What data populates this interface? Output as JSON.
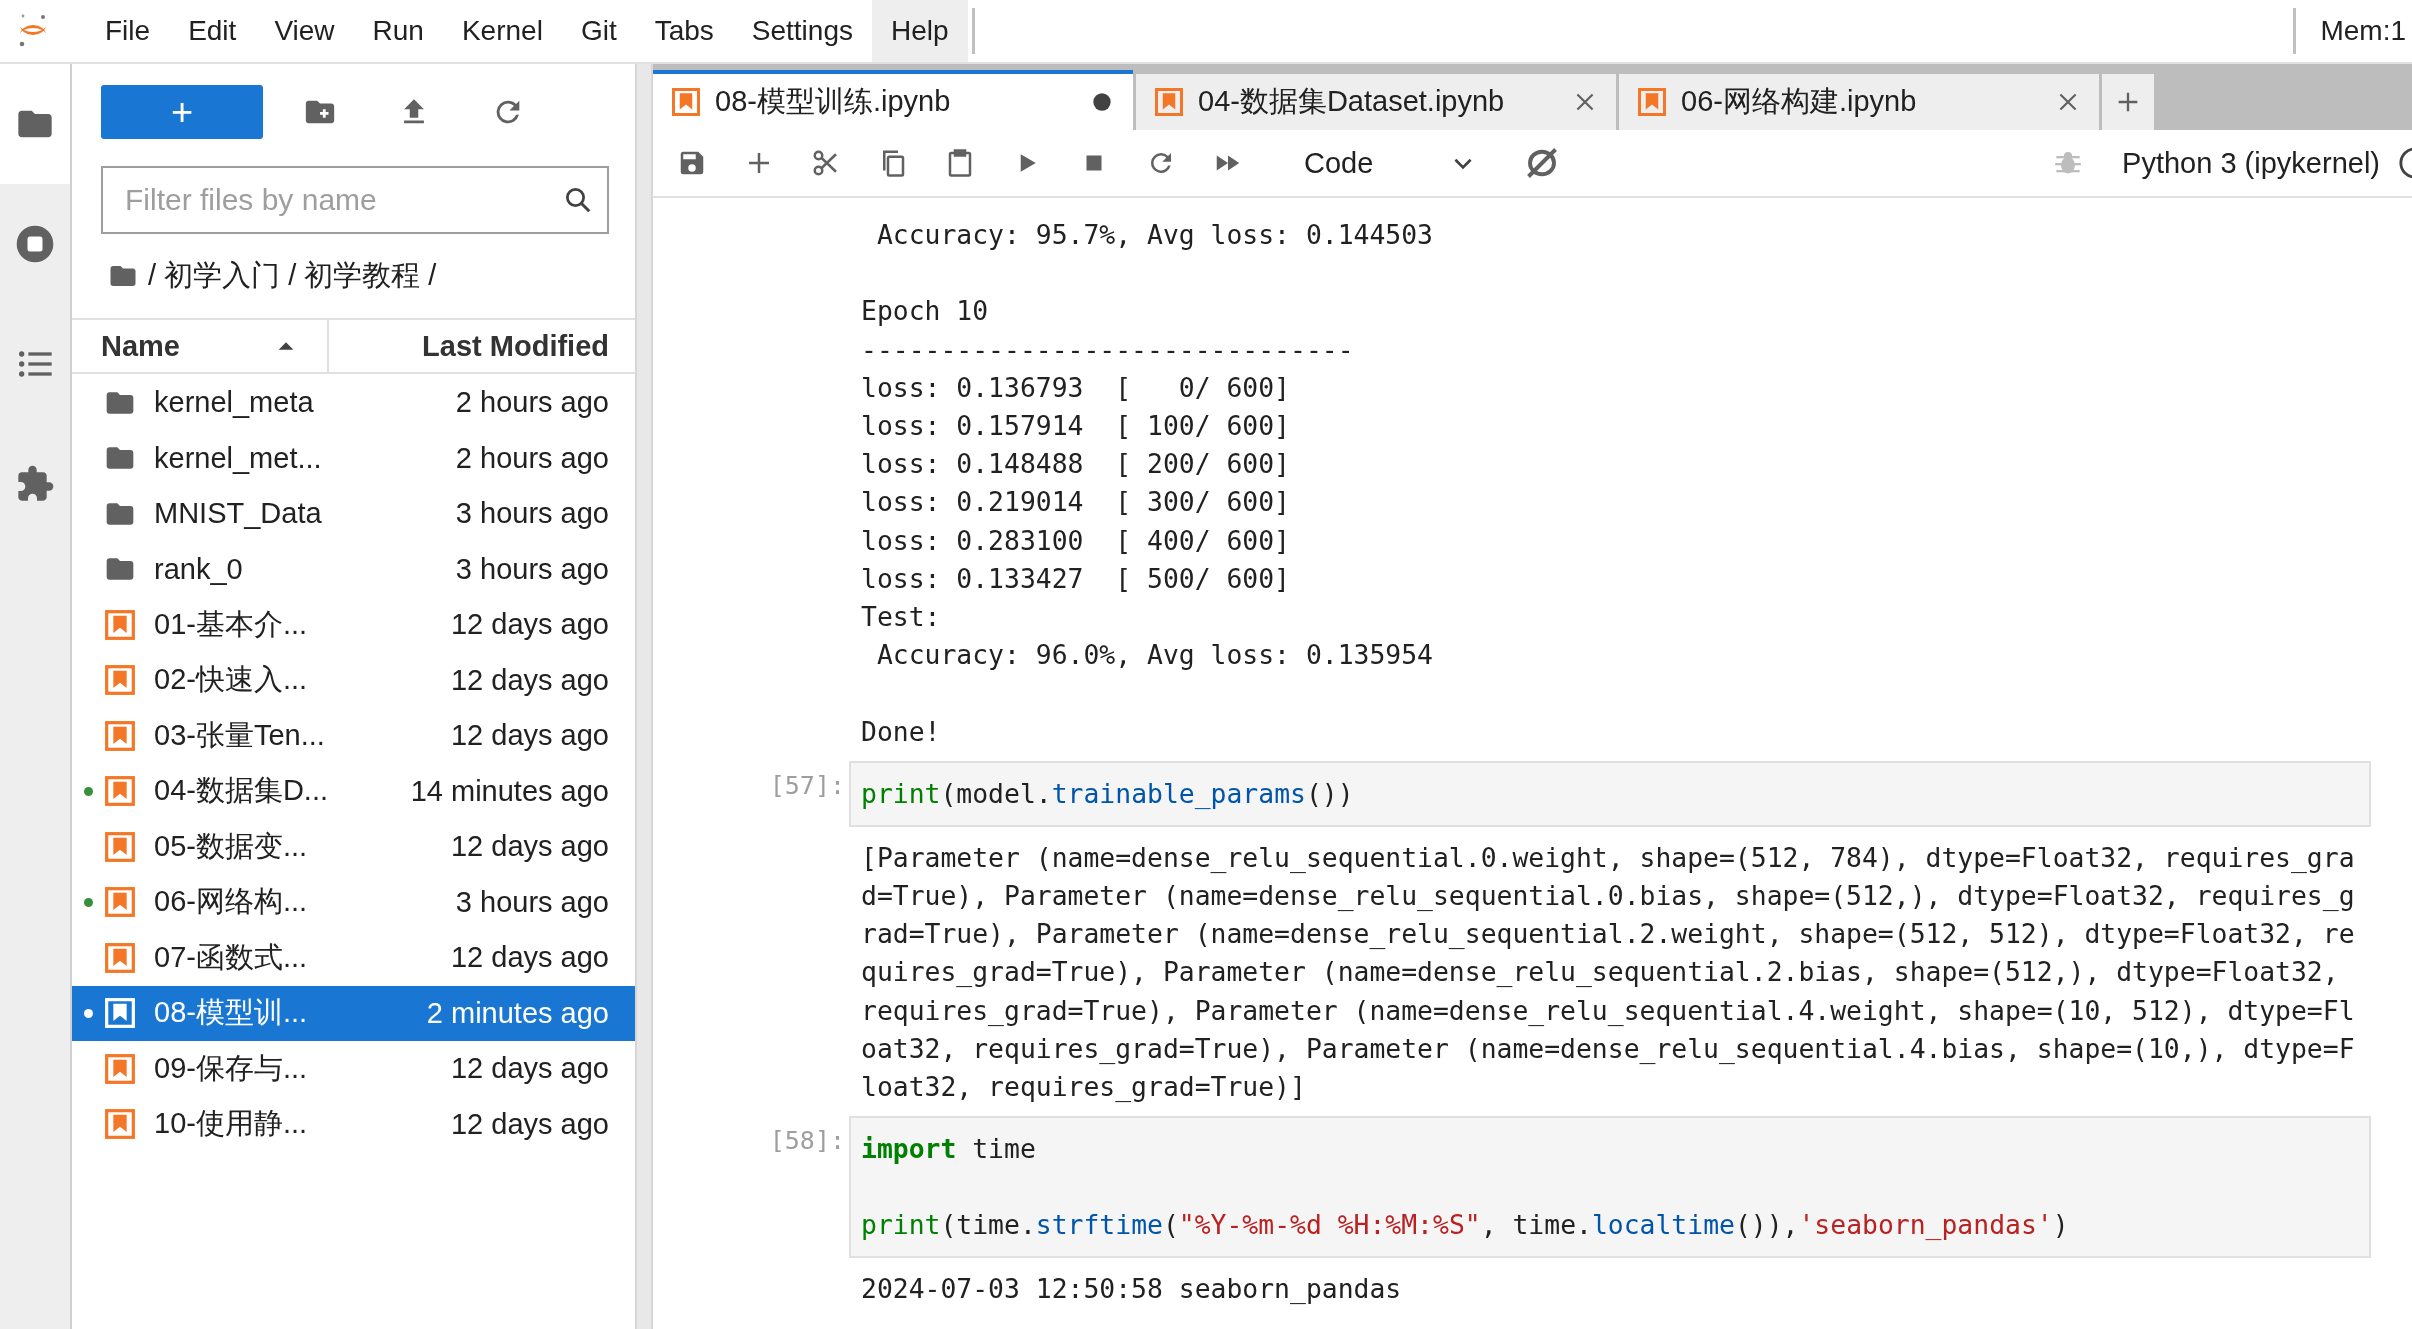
{
  "menu_bar": {
    "items": [
      {
        "label": "File",
        "selected": false
      },
      {
        "label": "Edit",
        "selected": false
      },
      {
        "label": "View",
        "selected": false
      },
      {
        "label": "Run",
        "selected": false
      },
      {
        "label": "Kernel",
        "selected": false
      },
      {
        "label": "Git",
        "selected": false
      },
      {
        "label": "Tabs",
        "selected": false
      },
      {
        "label": "Settings",
        "selected": false
      },
      {
        "label": "Help",
        "selected": true
      }
    ],
    "memory": "Mem:1"
  },
  "activity_bar": {
    "items": [
      {
        "kind": "files",
        "selected": true
      },
      {
        "kind": "running",
        "selected": false
      },
      {
        "kind": "toc",
        "selected": false
      },
      {
        "kind": "extensions",
        "selected": false
      }
    ]
  },
  "file_browser": {
    "new_button": "+",
    "filter": {
      "placeholder": "Filter files by name"
    },
    "breadcrumbs": "/ 初学入门 / 初学教程 /",
    "columns": [
      "Name",
      "Last Modified"
    ],
    "items": [
      {
        "kind": "folder",
        "name": "kernel_meta",
        "modified": "2 hours ago",
        "running": false,
        "selected": false
      },
      {
        "kind": "folder",
        "name": "kernel_met...",
        "modified": "2 hours ago",
        "running": false,
        "selected": false
      },
      {
        "kind": "folder",
        "name": "MNIST_Data",
        "modified": "3 hours ago",
        "running": false,
        "selected": false
      },
      {
        "kind": "folder",
        "name": "rank_0",
        "modified": "3 hours ago",
        "running": false,
        "selected": false
      },
      {
        "kind": "notebook",
        "name": "01-基本介...",
        "modified": "12 days ago",
        "running": false,
        "selected": false
      },
      {
        "kind": "notebook",
        "name": "02-快速入...",
        "modified": "12 days ago",
        "running": false,
        "selected": false
      },
      {
        "kind": "notebook",
        "name": "03-张量Ten...",
        "modified": "12 days ago",
        "running": false,
        "selected": false
      },
      {
        "kind": "notebook",
        "name": "04-数据集D...",
        "modified": "14 minutes ago",
        "running": true,
        "selected": false
      },
      {
        "kind": "notebook",
        "name": "05-数据变...",
        "modified": "12 days ago",
        "running": false,
        "selected": false
      },
      {
        "kind": "notebook",
        "name": "06-网络构...",
        "modified": "3 hours ago",
        "running": true,
        "selected": false
      },
      {
        "kind": "notebook",
        "name": "07-函数式...",
        "modified": "12 days ago",
        "running": false,
        "selected": false
      },
      {
        "kind": "notebook",
        "name": "08-模型训...",
        "modified": "2 minutes ago",
        "running": true,
        "selected": true
      },
      {
        "kind": "notebook",
        "name": "09-保存与...",
        "modified": "12 days ago",
        "running": false,
        "selected": false
      },
      {
        "kind": "notebook",
        "name": "10-使用静...",
        "modified": "12 days ago",
        "running": false,
        "selected": false
      }
    ]
  },
  "tabs": [
    {
      "title": "08-模型训练.ipynb",
      "selected": true,
      "dirty": true
    },
    {
      "title": "04-数据集Dataset.ipynb",
      "selected": false,
      "dirty": false
    },
    {
      "title": "06-网络构建.ipynb",
      "selected": false,
      "dirty": false
    }
  ],
  "toolbar": {
    "cell_type": "Code",
    "kernel": "Python 3 (ipykernel)"
  },
  "cells": [
    {
      "kind": "output",
      "output": " Accuracy: 95.7%, Avg loss: 0.144503\n\nEpoch 10\n-------------------------------\nloss: 0.136793  [   0/ 600]\nloss: 0.157914  [ 100/ 600]\nloss: 0.148488  [ 200/ 600]\nloss: 0.219014  [ 300/ 600]\nloss: 0.283100  [ 400/ 600]\nloss: 0.133427  [ 500/ 600]\nTest:\n Accuracy: 96.0%, Avg loss: 0.135954\n\nDone!"
    },
    {
      "kind": "code",
      "prompt": "[57]:",
      "source": [
        {
          "kind": "code",
          "tokens": [
            {
              "t": "print",
              "kind": "builtin"
            },
            {
              "t": "(model.",
              "kind": "plain"
            },
            {
              "t": "trainable_params",
              "kind": "attr"
            },
            {
              "t": "())",
              "kind": "plain"
            }
          ]
        }
      ],
      "output": "[Parameter (name=dense_relu_sequential.0.weight, shape=(512, 784), dtype=Float32, requires_grad=True), Parameter (name=dense_relu_sequential.0.bias, shape=(512,), dtype=Float32, requires_grad=True), Parameter (name=dense_relu_sequential.2.weight, shape=(512, 512), dtype=Float32, requires_grad=True), Parameter (name=dense_relu_sequential.2.bias, shape=(512,), dtype=Float32, requires_grad=True), Parameter (name=dense_relu_sequential.4.weight, shape=(10, 512), dtype=Float32, requires_grad=True), Parameter (name=dense_relu_sequential.4.bias, shape=(10,), dtype=Float32, requires_grad=True)]"
    },
    {
      "kind": "code",
      "prompt": "[58]:",
      "source": [
        {
          "kind": "code",
          "tokens": [
            {
              "t": "import",
              "kind": "keyword"
            },
            {
              "t": " time",
              "kind": "plain"
            }
          ]
        },
        {
          "kind": "blank"
        },
        {
          "kind": "code",
          "tokens": [
            {
              "t": "print",
              "kind": "builtin"
            },
            {
              "t": "(time.",
              "kind": "plain"
            },
            {
              "t": "strftime",
              "kind": "attr"
            },
            {
              "t": "(",
              "kind": "plain"
            },
            {
              "t": "\"%Y-%m-%d %H:%M:%S\"",
              "kind": "string"
            },
            {
              "t": ", time.",
              "kind": "plain"
            },
            {
              "t": "localtime",
              "kind": "attr"
            },
            {
              "t": "()),",
              "kind": "plain"
            },
            {
              "t": "'seaborn_pandas'",
              "kind": "string"
            },
            {
              "t": ")",
              "kind": "plain"
            }
          ]
        }
      ],
      "output": "2024-07-03 12:50:58 seaborn_pandas"
    }
  ]
}
